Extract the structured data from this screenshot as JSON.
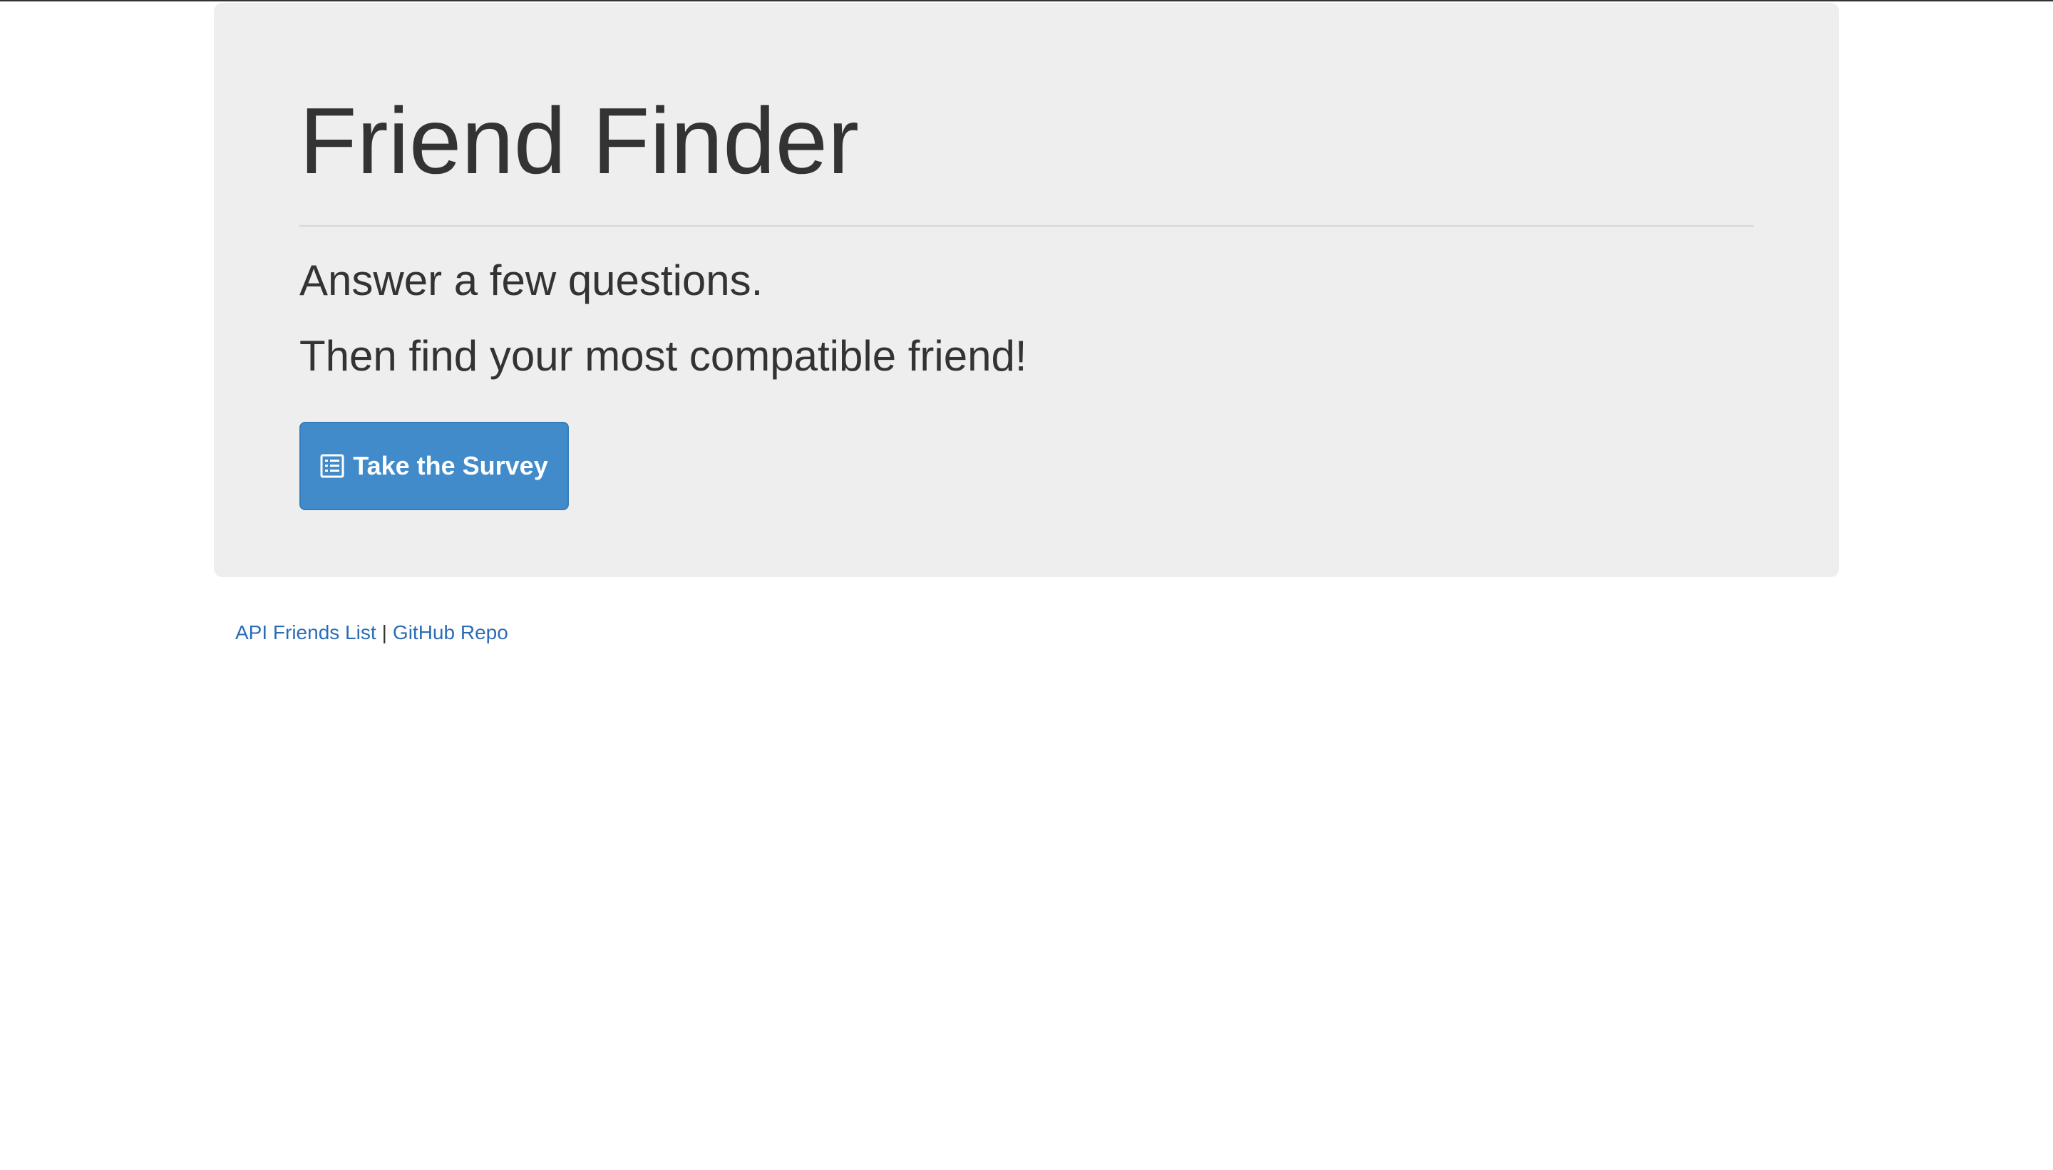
{
  "jumbotron": {
    "title": "Friend Finder",
    "subtitle_1": "Answer a few questions.",
    "subtitle_2": "Then find your most compatible friend!",
    "survey_button": {
      "label": "Take the Survey",
      "icon": "list-alt-icon"
    }
  },
  "footer": {
    "link_api": "API Friends List",
    "separator": "|",
    "link_github": "GitHub Repo"
  },
  "colors": {
    "jumbotron_bg": "#eeeeee",
    "button_primary": "#428bca",
    "link": "#2a6db7",
    "text": "#333333"
  }
}
